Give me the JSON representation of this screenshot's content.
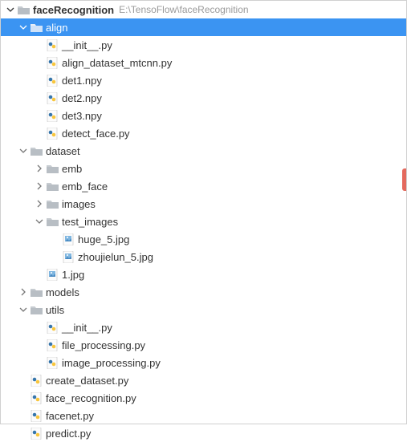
{
  "header": {
    "project_name": "faceRecognition",
    "project_path": "E:\\TensoFlow\\faceRecognition"
  },
  "tree": [
    {
      "depth": 1,
      "expand": "open",
      "kind": "folder",
      "label": "align",
      "selected": true
    },
    {
      "depth": 2,
      "expand": "none",
      "kind": "py",
      "label": "__init__.py"
    },
    {
      "depth": 2,
      "expand": "none",
      "kind": "py",
      "label": "align_dataset_mtcnn.py"
    },
    {
      "depth": 2,
      "expand": "none",
      "kind": "py",
      "label": "det1.npy"
    },
    {
      "depth": 2,
      "expand": "none",
      "kind": "py",
      "label": "det2.npy"
    },
    {
      "depth": 2,
      "expand": "none",
      "kind": "py",
      "label": "det3.npy"
    },
    {
      "depth": 2,
      "expand": "none",
      "kind": "py",
      "label": "detect_face.py"
    },
    {
      "depth": 1,
      "expand": "open",
      "kind": "folder",
      "label": "dataset"
    },
    {
      "depth": 2,
      "expand": "closed",
      "kind": "folder",
      "label": "emb"
    },
    {
      "depth": 2,
      "expand": "closed",
      "kind": "folder",
      "label": "emb_face"
    },
    {
      "depth": 2,
      "expand": "closed",
      "kind": "folder",
      "label": "images"
    },
    {
      "depth": 2,
      "expand": "open",
      "kind": "folder",
      "label": "test_images"
    },
    {
      "depth": 3,
      "expand": "none",
      "kind": "img",
      "label": "huge_5.jpg"
    },
    {
      "depth": 3,
      "expand": "none",
      "kind": "img",
      "label": "zhoujielun_5.jpg"
    },
    {
      "depth": 2,
      "expand": "none",
      "kind": "img",
      "label": "1.jpg"
    },
    {
      "depth": 1,
      "expand": "closed",
      "kind": "folder",
      "label": "models"
    },
    {
      "depth": 1,
      "expand": "open",
      "kind": "folder",
      "label": "utils"
    },
    {
      "depth": 2,
      "expand": "none",
      "kind": "py",
      "label": "__init__.py"
    },
    {
      "depth": 2,
      "expand": "none",
      "kind": "py",
      "label": "file_processing.py"
    },
    {
      "depth": 2,
      "expand": "none",
      "kind": "py",
      "label": "image_processing.py"
    },
    {
      "depth": 1,
      "expand": "none",
      "kind": "py",
      "label": "create_dataset.py"
    },
    {
      "depth": 1,
      "expand": "none",
      "kind": "py",
      "label": "face_recognition.py"
    },
    {
      "depth": 1,
      "expand": "none",
      "kind": "py",
      "label": "facenet.py"
    },
    {
      "depth": 1,
      "expand": "none",
      "kind": "py",
      "label": "predict.py"
    }
  ],
  "icons": {
    "chev_open_svg": "<svg width='10' height='10' viewBox='0 0 10 10'><path d='M1 3 L5 7 L9 3' fill='none' stroke='currentColor' stroke-width='1.3'/></svg>",
    "chev_open_sel_svg": "<svg width='10' height='10' viewBox='0 0 10 10'><path d='M1 3 L5 7 L9 3' fill='none' stroke='#fff' stroke-width='1.3'/></svg>",
    "chev_closed_svg": "<svg width='10' height='10' viewBox='0 0 10 10'><path d='M3 1 L7 5 L3 9' fill='none' stroke='#777' stroke-width='1.3'/></svg>",
    "folder_svg": "<svg width='15' height='13' viewBox='0 0 15 13'><path d='M0 2 L0 12 L15 12 L15 4 L7 4 L5.5 2 Z' fill='#c7ccd1'/><path d='M0 4 L15 4 L15 12 L0 12 Z' fill='#b8bec4'/></svg>",
    "folder_sel_svg": "<svg width='15' height='13' viewBox='0 0 15 13'><path d='M0 2 L0 12 L15 12 L15 4 L7 4 L5.5 2 Z' fill='#e8eef6'/><path d='M0 4 L15 4 L15 12 L0 12 Z' fill='#cfe2f8'/></svg>",
    "py_svg": "<svg width='14' height='15' viewBox='0 0 14 15'><rect x='1' y='0' width='12' height='15' rx='1' fill='#fcfcfc' stroke='#cfcfcf' stroke-width='0.8'/><circle cx='5' cy='6' r='2.3' fill='#3776ab'/><circle cx='9' cy='9' r='2.3' fill='#f8c63d'/></svg>",
    "img_svg": "<svg width='14' height='15' viewBox='0 0 14 15'><rect x='1' y='0' width='12' height='15' rx='1' fill='#fcfcfc' stroke='#cfcfcf' stroke-width='0.8'/><rect x='3' y='3' width='8' height='7' fill='#7fb6e0'/><circle cx='6' cy='5' r='1' fill='#fff'/><path d='M3 10 L6 7 L8 9 L11 6 L11 10 Z' fill='#4a8bc2'/></svg>"
  }
}
